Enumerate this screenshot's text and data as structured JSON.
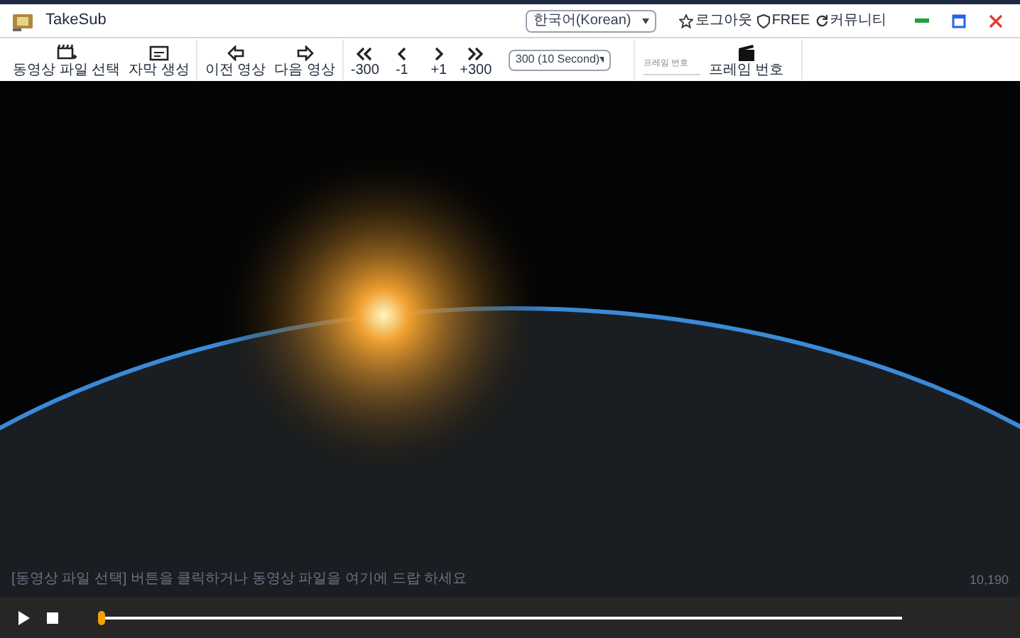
{
  "window": {
    "title": "TakeSub"
  },
  "language": {
    "value": "한국어(Korean)"
  },
  "header_links": [
    {
      "kind": "login",
      "label": "로그아웃"
    },
    {
      "kind": "plan",
      "label": "FREE"
    },
    {
      "kind": "community",
      "label": "커뮤니티"
    }
  ],
  "toolbar": {
    "groups": [
      [
        {
          "kind": "film",
          "label": "동영상 파일 선택"
        },
        {
          "kind": "subtitle",
          "label": "자막 생성"
        }
      ],
      [
        {
          "kind": "left",
          "label": "이전 영상"
        },
        {
          "kind": "right",
          "label": "다음 영상"
        }
      ],
      [
        {
          "kind": "dleft",
          "label": "-300"
        },
        {
          "kind": "sleft",
          "label": "-1"
        },
        {
          "kind": "sright",
          "label": "+1"
        },
        {
          "kind": "dright",
          "label": "+300"
        }
      ]
    ],
    "step": {
      "value": "300 (10 Second)"
    },
    "frame_field": {
      "placeholder": "프레임 번호"
    },
    "frame_button": {
      "label": "프레임 번호"
    }
  },
  "video": {
    "hint": "[동영상 파일 선택] 버튼을 클릭하거나 동영상 파일을 여기에 드랍 하세요",
    "counter": "10,190"
  },
  "player": {
    "seek": {
      "level": 0
    }
  }
}
